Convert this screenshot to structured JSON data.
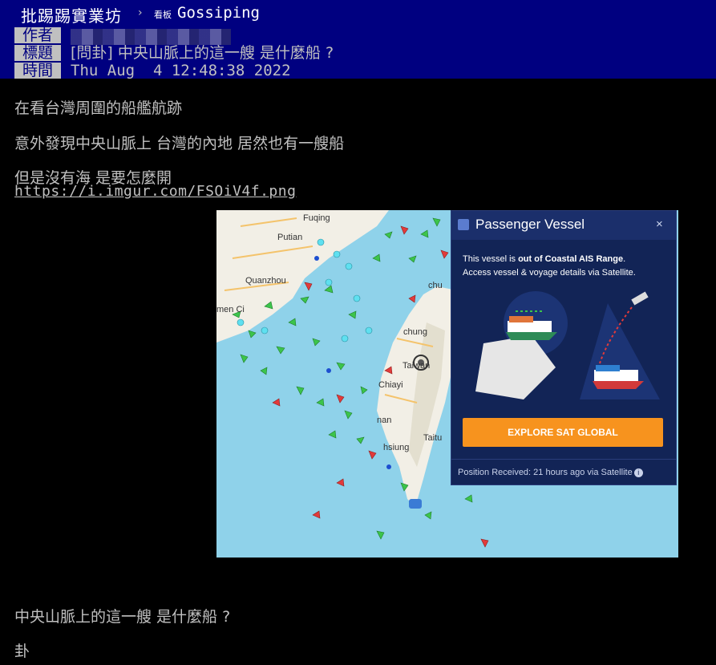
{
  "nav": {
    "board_chinese": "批踢踢實業坊",
    "arrow": "›",
    "board_tag": "看板",
    "board_name": "Gossiping"
  },
  "header": {
    "author_label": "作者",
    "title_label": "標題",
    "title_value": "[問卦] 中央山脈上的這一艘 是什麼船 ?",
    "time_label": "時間",
    "time_value": "Thu Aug  4 12:48:38 2022"
  },
  "post": {
    "line1": "在看台灣周圍的船艦航跡",
    "line2": "意外發現中央山脈上 台灣的內地 居然也有一艘船",
    "line3": "但是沒有海 是要怎麼開",
    "link": "https://i.imgur.com/FSOiV4f.png",
    "line4": "中央山脈上的這一艘 是什麼船 ?",
    "line5": "卦"
  },
  "map": {
    "cities": {
      "fuqing": "Fuqing",
      "putian": "Putian",
      "quanzhou": "Quanzhou",
      "chu": "chu",
      "chung": "chung",
      "taiwan": "Taiwan",
      "chiayi": "Chiayi",
      "nan": "nan",
      "hsiung": "hsiung",
      "taitu": "Taitu",
      "men_ci": "men Ci"
    },
    "popup": {
      "title": "Passenger Vessel",
      "close": "×",
      "text_pre": "This vessel is ",
      "text_bold": "out of Coastal AIS Range",
      "text_post": ".",
      "text_line2": "Access vessel & voyage details via Satellite.",
      "button": "EXPLORE SAT GLOBAL",
      "footer": "Position Received: 21 hours ago via Satellite",
      "info_icon": "i"
    },
    "colors": {
      "sea": "#8fd2ea",
      "land": "#f2efe6",
      "popup_bg": "#122456",
      "button": "#f7931e"
    }
  }
}
